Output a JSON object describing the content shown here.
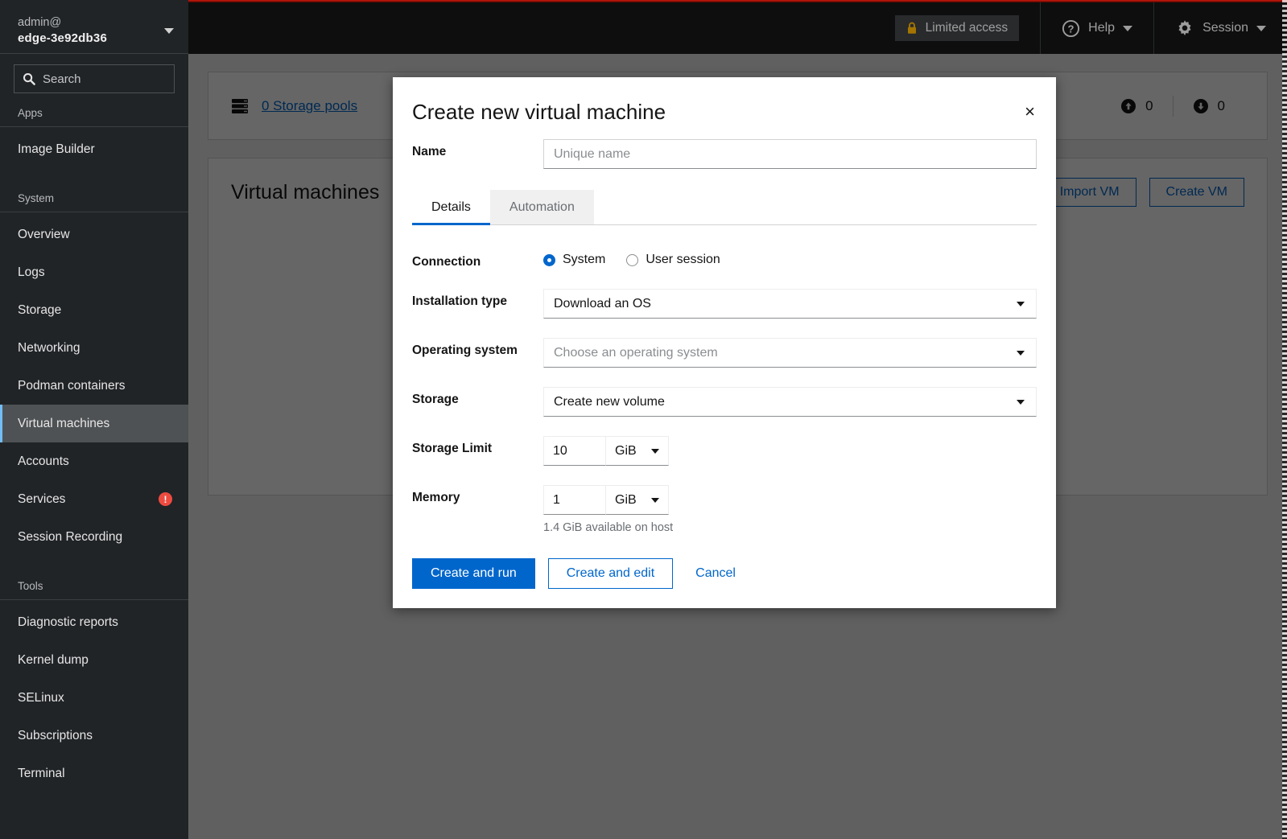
{
  "sidebar": {
    "account": {
      "user": "admin@",
      "host": "edge-3e92db36",
      "caret_icon": "chevron-down-icon"
    },
    "search": {
      "placeholder": "Search",
      "icon": "search-icon"
    },
    "groups": [
      {
        "title": "Apps",
        "items": [
          {
            "label": "Image Builder",
            "active": false,
            "alert": false
          }
        ]
      },
      {
        "title": "System",
        "items": [
          {
            "label": "Overview",
            "active": false,
            "alert": false
          },
          {
            "label": "Logs",
            "active": false,
            "alert": false
          },
          {
            "label": "Storage",
            "active": false,
            "alert": false
          },
          {
            "label": "Networking",
            "active": false,
            "alert": false
          },
          {
            "label": "Podman containers",
            "active": false,
            "alert": false
          },
          {
            "label": "Virtual machines",
            "active": true,
            "alert": false
          },
          {
            "label": "Accounts",
            "active": false,
            "alert": false
          },
          {
            "label": "Services",
            "active": false,
            "alert": true,
            "alert_text": "!"
          },
          {
            "label": "Session Recording",
            "active": false,
            "alert": false
          }
        ]
      },
      {
        "title": "Tools",
        "items": [
          {
            "label": "Diagnostic reports",
            "active": false,
            "alert": false
          },
          {
            "label": "Kernel dump",
            "active": false,
            "alert": false
          },
          {
            "label": "SELinux",
            "active": false,
            "alert": false
          },
          {
            "label": "Subscriptions",
            "active": false,
            "alert": false
          },
          {
            "label": "Terminal",
            "active": false,
            "alert": false
          }
        ]
      }
    ]
  },
  "header": {
    "limited_access": {
      "label": "Limited access",
      "icon": "lock-icon",
      "accent": "#f0ab00"
    },
    "help": {
      "label": "Help",
      "icon": "question-circle-icon",
      "caret_icon": "chevron-down-icon"
    },
    "session": {
      "label": "Session",
      "icon": "gear-icon",
      "caret_icon": "chevron-down-icon"
    }
  },
  "main": {
    "storage_pools": {
      "label": "0 Storage pools",
      "icon": "server-stack-icon",
      "upload": {
        "icon": "arrow-up-circle-icon",
        "value": "0"
      },
      "download": {
        "icon": "arrow-down-circle-icon",
        "value": "0"
      }
    },
    "vms": {
      "title": "Virtual machines",
      "import_label": "Import VM",
      "create_label": "Create VM"
    }
  },
  "modal": {
    "title": "Create new virtual machine",
    "close_icon": "close-icon",
    "close_label": "×",
    "name": {
      "label": "Name",
      "value": "",
      "placeholder": "Unique name"
    },
    "tabs": [
      {
        "label": "Details",
        "active": true
      },
      {
        "label": "Automation",
        "active": false
      }
    ],
    "connection": {
      "label": "Connection",
      "options": [
        {
          "label": "System",
          "checked": true
        },
        {
          "label": "User session",
          "checked": false
        }
      ]
    },
    "installation_type": {
      "label": "Installation type",
      "value": "Download an OS",
      "is_placeholder": false
    },
    "operating_system": {
      "label": "Operating system",
      "value": "Choose an operating system",
      "is_placeholder": true
    },
    "storage": {
      "label": "Storage",
      "value": "Create new volume",
      "is_placeholder": false
    },
    "storage_limit": {
      "label": "Storage Limit",
      "value": "10",
      "unit": "GiB"
    },
    "memory": {
      "label": "Memory",
      "value": "1",
      "unit": "GiB",
      "helper": "1.4 GiB available on host"
    },
    "footer": {
      "create_and_run": "Create and run",
      "create_and_edit": "Create and edit",
      "cancel": "Cancel"
    },
    "accent_color": "#0066cc"
  }
}
